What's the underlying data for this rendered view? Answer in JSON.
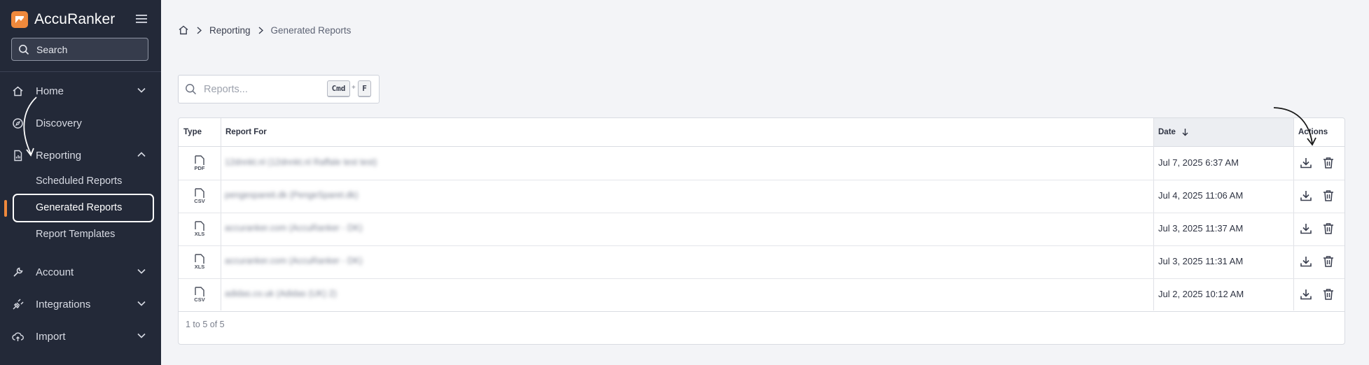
{
  "app": {
    "name": "AccuRanker"
  },
  "colors": {
    "brand": "#f0893c",
    "sidebar_bg": "#232938",
    "page_bg": "#f3f4f7"
  },
  "sidebar": {
    "search_placeholder": "Search",
    "items": [
      {
        "label": "Home",
        "icon": "home-icon"
      },
      {
        "label": "Discovery",
        "icon": "compass-icon"
      },
      {
        "label": "Reporting",
        "icon": "report-icon"
      },
      {
        "label": "Account",
        "icon": "wrench-icon"
      },
      {
        "label": "Integrations",
        "icon": "plug-icon"
      },
      {
        "label": "Import",
        "icon": "cloud-upload-icon"
      }
    ],
    "reporting_sub": [
      {
        "label": "Scheduled Reports"
      },
      {
        "label": "Generated Reports"
      },
      {
        "label": "Report Templates"
      }
    ]
  },
  "breadcrumb": {
    "home": "home-icon",
    "parent": "Reporting",
    "current": "Generated Reports"
  },
  "report_search": {
    "placeholder": "Reports...",
    "kbd_cmd": "Cmd",
    "kbd_plus": "+",
    "kbd_f": "F"
  },
  "table": {
    "columns": {
      "type": "Type",
      "report_for": "Report For",
      "date": "Date",
      "actions": "Actions"
    },
    "sort": "date-desc",
    "rows": [
      {
        "type": "PDF",
        "report_for": "12dnnkt.nl (12dnnkt.nl Raffale test test)",
        "date": "Jul 7, 2025 6:37 AM"
      },
      {
        "type": "CSV",
        "report_for": "pengespareit.dk (PengeSparet.dk)",
        "date": "Jul 4, 2025 11:06 AM"
      },
      {
        "type": "XLS",
        "report_for": "accuranker.com (AccuRanker - DK)",
        "date": "Jul 3, 2025 11:37 AM"
      },
      {
        "type": "XLS",
        "report_for": "accuranker.com (AccuRanker - DK)",
        "date": "Jul 3, 2025 11:31 AM"
      },
      {
        "type": "CSV",
        "report_for": "adidas.co.uk (Adidas (UK) 2)",
        "date": "Jul 2, 2025 10:12 AM"
      }
    ],
    "pagination": "1 to 5 of 5"
  }
}
